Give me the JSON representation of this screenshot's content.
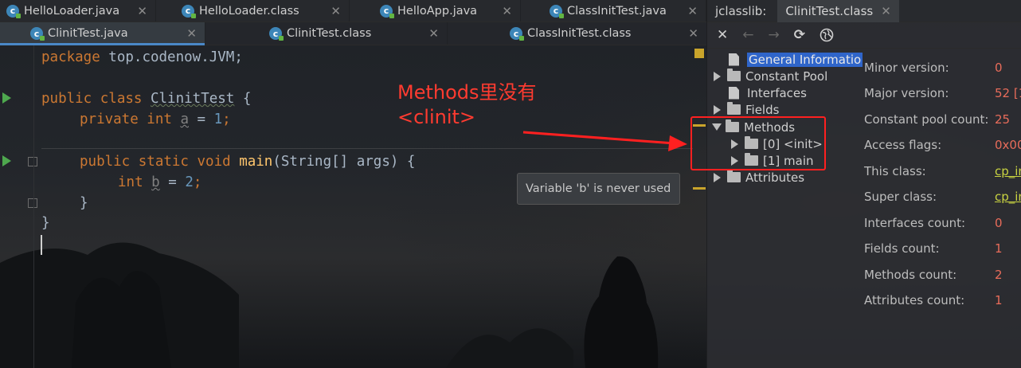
{
  "editor_tabs_row1": [
    {
      "label": "HelloLoader.java",
      "icon": "java-class-icon"
    },
    {
      "label": "HelloLoader.class",
      "icon": "java-class-icon"
    },
    {
      "label": "HelloApp.java",
      "icon": "java-class-icon"
    },
    {
      "label": "ClassInitTest.java",
      "icon": "java-class-icon"
    }
  ],
  "editor_tabs_row2": [
    {
      "label": "ClinitTest.java",
      "active": true
    },
    {
      "label": "ClinitTest.class",
      "active": false
    },
    {
      "label": "ClassInitTest.class",
      "active": false
    }
  ],
  "code": {
    "l1_kw": "package",
    "l1_rest": " top.codenow.JVM;",
    "l3_kw": "public class",
    "l3_name": "ClinitTest",
    "l3_rest": " {",
    "l4_kw": "private int",
    "l4_var": "a",
    "l4_eq": " = ",
    "l4_num": "1",
    "l4_end": ";",
    "l6_kw": "public static void",
    "l6_fn": "main",
    "l6_rest": "(String[] args) {",
    "l7_kw": "int",
    "l7_var": "b",
    "l7_eq": " = ",
    "l7_num": "2",
    "l7_end": ";",
    "l8": "}",
    "l9": "}"
  },
  "annotation": {
    "line1": "Methods里没有",
    "line2": "<clinit>",
    "color": "#ff3b30"
  },
  "tooltip": "Variable 'b' is never used",
  "jclasslib": {
    "tool_label": "jclasslib:",
    "tab_label": "ClinitTest.class",
    "toolbar_icons": [
      "close-icon",
      "back-arrow-icon",
      "forward-arrow-icon",
      "refresh-icon",
      "browser-icon"
    ],
    "tree": {
      "general": "General Informatio",
      "constant_pool": "Constant Pool",
      "interfaces": "Interfaces",
      "fields": "Fields",
      "methods": "Methods",
      "method0": "[0] <init>",
      "method1": "[1] main",
      "attributes": "Attributes"
    },
    "info": [
      {
        "label": "Minor version:",
        "value": "0",
        "link": false
      },
      {
        "label": "Major version:",
        "value": "52 [1",
        "link": false
      },
      {
        "label": "Constant pool count:",
        "value": "25",
        "link": false
      },
      {
        "label": "Access flags:",
        "value": "0x00",
        "link": false
      },
      {
        "label": "This class:",
        "value": "cp_in",
        "link": true
      },
      {
        "label": "Super class:",
        "value": "cp_in",
        "link": true
      },
      {
        "label": "Interfaces count:",
        "value": "0",
        "link": false
      },
      {
        "label": "Fields count:",
        "value": "1",
        "link": false
      },
      {
        "label": "Methods count:",
        "value": "2",
        "link": false
      },
      {
        "label": "Attributes count:",
        "value": "1",
        "link": false
      }
    ]
  }
}
